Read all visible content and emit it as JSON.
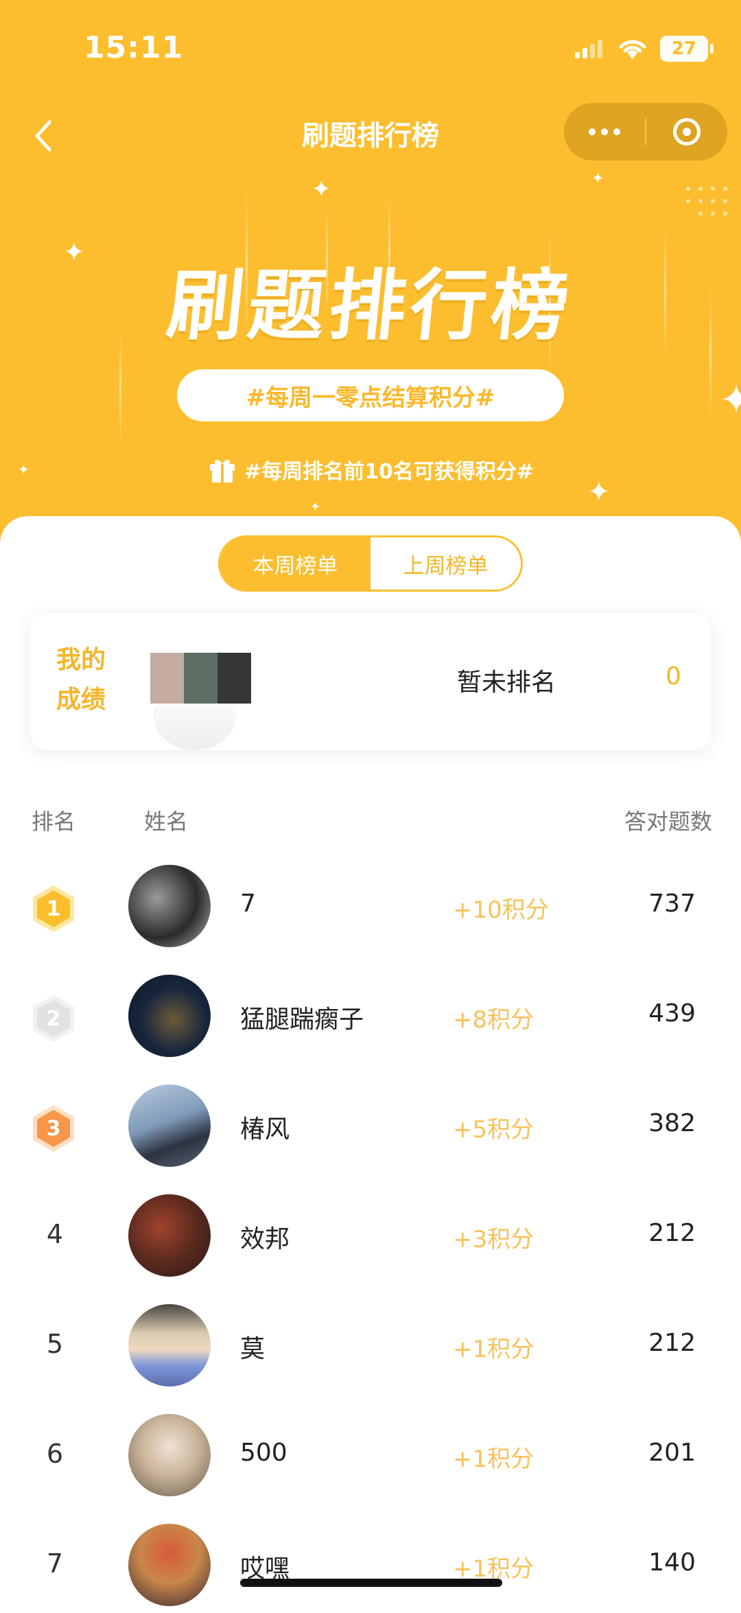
{
  "status_bar": {
    "time": "15:11",
    "battery": "27"
  },
  "nav": {
    "title": "刷题排行榜"
  },
  "banner": {
    "title": "刷题排行榜",
    "pill_text": "#每周一零点结算积分#",
    "hint_text": "#每周排名前10名可获得积分#"
  },
  "tabs": [
    {
      "label": "本周榜单",
      "active": true
    },
    {
      "label": "上周榜单",
      "active": false
    }
  ],
  "my_result": {
    "label": "我的成绩",
    "rank_text": "暂未排名",
    "score": "0",
    "avatar_colors": [
      "#c4aca3",
      "#5e7066",
      "#363636"
    ]
  },
  "table_headers": {
    "rank": "排名",
    "name": "姓名",
    "count": "答对题数"
  },
  "leaderboard": [
    {
      "rank": "1",
      "name": "7",
      "points": "+10积分",
      "count": "737",
      "badge": "gold"
    },
    {
      "rank": "2",
      "name": "猛腿踹瘸子",
      "points": "+8积分",
      "count": "439",
      "badge": "silver"
    },
    {
      "rank": "3",
      "name": "椿风",
      "points": "+5积分",
      "count": "382",
      "badge": "bronze"
    },
    {
      "rank": "4",
      "name": "效邦",
      "points": "+3积分",
      "count": "212"
    },
    {
      "rank": "5",
      "name": "莫",
      "points": "+1积分",
      "count": "212"
    },
    {
      "rank": "6",
      "name": "500",
      "points": "+1积分",
      "count": "201"
    },
    {
      "rank": "7",
      "name": "哎嘿",
      "points": "+1积分",
      "count": "140"
    }
  ],
  "colors": {
    "primary": "#fcbe2e",
    "points": "#f8c25a"
  }
}
